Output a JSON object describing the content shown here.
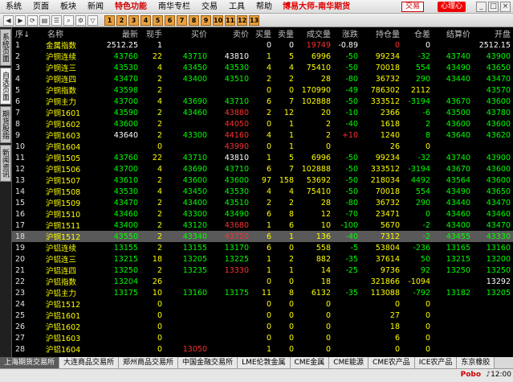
{
  "menu": [
    "系统",
    "页面",
    "板块",
    "新闻",
    "特色功能",
    "南华专栏",
    "交易",
    "工具",
    "帮助"
  ],
  "app_title": "博易大师-南华期货",
  "trade_label": "交易",
  "heart_label": "心理心",
  "window_controls": [
    "_",
    "□",
    "×"
  ],
  "toolbar_icons": [
    "back-icon",
    "forward-icon",
    "refresh-icon",
    "chart-icon",
    "list-icon",
    "search-icon",
    "settings-icon",
    "filter-icon"
  ],
  "toolbar_nums": [
    "1",
    "2",
    "3",
    "4",
    "5",
    "6",
    "7",
    "8",
    "9",
    "10",
    "11",
    "12",
    "13"
  ],
  "side_tabs": [
    "系统页面",
    "自选页面",
    "期货股指",
    "新闻资讯"
  ],
  "headers": [
    "序↓",
    "名称",
    "最新",
    "现手",
    "买价",
    "卖价",
    "买量",
    "卖量",
    "成交量",
    "涨跌",
    "持仓量",
    "仓差",
    "结算价",
    "开盘"
  ],
  "rows": [
    {
      "seq": "1",
      "name": "金属指数",
      "last": "2512.25",
      "vol": "1",
      "bid": "",
      "ask": "",
      "bq": "0",
      "aq": "0",
      "tvol": "19749",
      "chg": "-0.89",
      "oi": "0",
      "oid": "0",
      "settle": "",
      "open": "2512.15",
      "c": [
        "w",
        "w",
        "",
        "",
        "w",
        "w",
        "r",
        "w",
        "r",
        "w",
        "w",
        "w"
      ]
    },
    {
      "seq": "2",
      "name": "沪铜连续",
      "last": "43760",
      "vol": "22",
      "bid": "43710",
      "ask": "43810",
      "bq": "1",
      "aq": "5",
      "tvol": "6996",
      "chg": "-50",
      "oi": "99234",
      "oid": "-32",
      "settle": "43740",
      "open": "43900",
      "c": [
        "g",
        "y",
        "g",
        "w",
        "y",
        "y",
        "y",
        "g",
        "y",
        "g",
        "g",
        "g"
      ]
    },
    {
      "seq": "3",
      "name": "沪铜连三",
      "last": "43530",
      "vol": "4",
      "bid": "43450",
      "ask": "43530",
      "bq": "4",
      "aq": "4",
      "tvol": "75410",
      "chg": "-50",
      "oi": "70018",
      "oid": "554",
      "settle": "43490",
      "open": "43650",
      "c": [
        "g",
        "y",
        "g",
        "g",
        "y",
        "y",
        "y",
        "g",
        "y",
        "g",
        "g",
        "g"
      ]
    },
    {
      "seq": "4",
      "name": "沪铜连四",
      "last": "43470",
      "vol": "2",
      "bid": "43400",
      "ask": "43510",
      "bq": "2",
      "aq": "2",
      "tvol": "28",
      "chg": "-80",
      "oi": "36732",
      "oid": "290",
      "settle": "43440",
      "open": "43470",
      "c": [
        "g",
        "y",
        "g",
        "g",
        "y",
        "y",
        "y",
        "g",
        "y",
        "g",
        "g",
        "g"
      ]
    },
    {
      "seq": "5",
      "name": "沪铜指数",
      "last": "43598",
      "vol": "2",
      "bid": "",
      "ask": "",
      "bq": "0",
      "aq": "0",
      "tvol": "170990",
      "chg": "-49",
      "oi": "786302",
      "oid": "2112",
      "settle": "",
      "open": "43570",
      "c": [
        "g",
        "y",
        "",
        "",
        "y",
        "y",
        "y",
        "g",
        "y",
        "y",
        "",
        "g"
      ]
    },
    {
      "seq": "6",
      "name": "沪铜主力",
      "last": "43700",
      "vol": "4",
      "bid": "43690",
      "ask": "43710",
      "bq": "6",
      "aq": "7",
      "tvol": "102888",
      "chg": "-50",
      "oi": "333512",
      "oid": "-3194",
      "settle": "43670",
      "open": "43600",
      "c": [
        "g",
        "y",
        "g",
        "g",
        "y",
        "y",
        "y",
        "g",
        "y",
        "g",
        "g",
        "g"
      ]
    },
    {
      "seq": "7",
      "name": "沪铜1601",
      "last": "43590",
      "vol": "2",
      "bid": "43460",
      "ask": "43880",
      "bq": "2",
      "aq": "12",
      "tvol": "20",
      "chg": "-10",
      "oi": "2366",
      "oid": "-6",
      "settle": "43500",
      "open": "43780",
      "c": [
        "g",
        "y",
        "g",
        "r",
        "y",
        "y",
        "y",
        "g",
        "y",
        "g",
        "g",
        "g"
      ]
    },
    {
      "seq": "8",
      "name": "沪铜1602",
      "last": "43600",
      "vol": "2",
      "bid": "",
      "ask": "44050",
      "bq": "0",
      "aq": "1",
      "tvol": "2",
      "chg": "-40",
      "oi": "1618",
      "oid": "2",
      "settle": "43600",
      "open": "43600",
      "c": [
        "g",
        "y",
        "",
        "r",
        "y",
        "y",
        "y",
        "g",
        "y",
        "g",
        "g",
        "g"
      ]
    },
    {
      "seq": "9",
      "name": "沪铜1603",
      "last": "43640",
      "vol": "2",
      "bid": "43300",
      "ask": "44160",
      "bq": "4",
      "aq": "1",
      "tvol": "2",
      "chg": "+10",
      "oi": "1240",
      "oid": "8",
      "settle": "43640",
      "open": "43620",
      "c": [
        "w",
        "y",
        "g",
        "r",
        "y",
        "y",
        "y",
        "r",
        "y",
        "g",
        "g",
        "g"
      ]
    },
    {
      "seq": "10",
      "name": "沪铜1604",
      "last": "",
      "vol": "0",
      "bid": "",
      "ask": "43990",
      "bq": "0",
      "aq": "1",
      "tvol": "0",
      "chg": "",
      "oi": "26",
      "oid": "0",
      "settle": "",
      "open": "",
      "c": [
        "",
        "y",
        "",
        "r",
        "y",
        "y",
        "y",
        "",
        "y",
        "y",
        "",
        ""
      ]
    },
    {
      "seq": "11",
      "name": "沪铜1505",
      "last": "43760",
      "vol": "22",
      "bid": "43710",
      "ask": "43810",
      "bq": "1",
      "aq": "5",
      "tvol": "6996",
      "chg": "-50",
      "oi": "99234",
      "oid": "-32",
      "settle": "43740",
      "open": "43900",
      "c": [
        "g",
        "y",
        "g",
        "w",
        "y",
        "y",
        "y",
        "g",
        "y",
        "g",
        "g",
        "g"
      ]
    },
    {
      "seq": "12",
      "name": "沪铜1506",
      "last": "43700",
      "vol": "4",
      "bid": "43690",
      "ask": "43710",
      "bq": "6",
      "aq": "7",
      "tvol": "102888",
      "chg": "-50",
      "oi": "333512",
      "oid": "-3194",
      "settle": "43670",
      "open": "43600",
      "c": [
        "g",
        "y",
        "g",
        "g",
        "y",
        "y",
        "y",
        "g",
        "y",
        "g",
        "g",
        "g"
      ]
    },
    {
      "seq": "13",
      "name": "沪铜1507",
      "last": "43610",
      "vol": "2",
      "bid": "43600",
      "ask": "43600",
      "bq": "97",
      "aq": "158",
      "tvol": "53692",
      "chg": "-50",
      "oi": "218034",
      "oid": "4492",
      "settle": "43564",
      "open": "43600",
      "c": [
        "g",
        "y",
        "g",
        "g",
        "y",
        "y",
        "y",
        "g",
        "y",
        "g",
        "g",
        "g"
      ]
    },
    {
      "seq": "14",
      "name": "沪铜1508",
      "last": "43530",
      "vol": "4",
      "bid": "43450",
      "ask": "43530",
      "bq": "4",
      "aq": "4",
      "tvol": "75410",
      "chg": "-50",
      "oi": "70018",
      "oid": "554",
      "settle": "43490",
      "open": "43650",
      "c": [
        "g",
        "y",
        "g",
        "g",
        "y",
        "y",
        "y",
        "g",
        "y",
        "g",
        "g",
        "g"
      ]
    },
    {
      "seq": "15",
      "name": "沪铜1509",
      "last": "43470",
      "vol": "2",
      "bid": "43400",
      "ask": "43510",
      "bq": "2",
      "aq": "2",
      "tvol": "28",
      "chg": "-80",
      "oi": "36732",
      "oid": "290",
      "settle": "43440",
      "open": "43470",
      "c": [
        "g",
        "y",
        "g",
        "g",
        "y",
        "y",
        "y",
        "g",
        "y",
        "g",
        "g",
        "g"
      ]
    },
    {
      "seq": "16",
      "name": "沪铜1510",
      "last": "43460",
      "vol": "2",
      "bid": "43300",
      "ask": "43490",
      "bq": "6",
      "aq": "8",
      "tvol": "12",
      "chg": "-70",
      "oi": "23471",
      "oid": "0",
      "settle": "43460",
      "open": "43460",
      "c": [
        "g",
        "y",
        "g",
        "g",
        "y",
        "y",
        "y",
        "g",
        "y",
        "g",
        "g",
        "g"
      ]
    },
    {
      "seq": "17",
      "name": "沪铜1511",
      "last": "43400",
      "vol": "2",
      "bid": "43120",
      "ask": "43680",
      "bq": "1",
      "aq": "6",
      "tvol": "10",
      "chg": "-100",
      "oi": "5670",
      "oid": "-2",
      "settle": "43400",
      "open": "43470",
      "c": [
        "g",
        "y",
        "g",
        "r",
        "y",
        "y",
        "y",
        "g",
        "y",
        "g",
        "g",
        "g"
      ]
    },
    {
      "seq": "18",
      "name": "沪铜1512",
      "last": "43550",
      "vol": "2",
      "bid": "43340",
      "ask": "43720",
      "bq": "6",
      "aq": "1",
      "tvol": "136",
      "chg": "-40",
      "oi": "7312",
      "oid": "-2",
      "settle": "43455",
      "open": "43330",
      "c": [
        "g",
        "y",
        "g",
        "r",
        "y",
        "y",
        "y",
        "g",
        "y",
        "g",
        "g",
        "g"
      ],
      "hl": true
    },
    {
      "seq": "19",
      "name": "沪铝连续",
      "last": "13155",
      "vol": "2",
      "bid": "13155",
      "ask": "13170",
      "bq": "6",
      "aq": "0",
      "tvol": "558",
      "chg": "-5",
      "oi": "53804",
      "oid": "-236",
      "settle": "13165",
      "open": "13160",
      "c": [
        "g",
        "y",
        "g",
        "g",
        "y",
        "y",
        "y",
        "g",
        "y",
        "g",
        "g",
        "g"
      ]
    },
    {
      "seq": "20",
      "name": "沪铝连三",
      "last": "13215",
      "vol": "18",
      "bid": "13205",
      "ask": "13225",
      "bq": "1",
      "aq": "2",
      "tvol": "882",
      "chg": "-35",
      "oi": "37614",
      "oid": "50",
      "settle": "13215",
      "open": "13200",
      "c": [
        "g",
        "y",
        "g",
        "g",
        "y",
        "y",
        "y",
        "g",
        "y",
        "g",
        "g",
        "g"
      ]
    },
    {
      "seq": "21",
      "name": "沪铝连四",
      "last": "13250",
      "vol": "2",
      "bid": "13235",
      "ask": "13330",
      "bq": "1",
      "aq": "1",
      "tvol": "14",
      "chg": "-25",
      "oi": "9736",
      "oid": "92",
      "settle": "13250",
      "open": "13250",
      "c": [
        "g",
        "y",
        "g",
        "r",
        "y",
        "y",
        "y",
        "g",
        "y",
        "g",
        "g",
        "g"
      ]
    },
    {
      "seq": "22",
      "name": "沪铝指数",
      "last": "13204",
      "vol": "26",
      "bid": "",
      "ask": "",
      "bq": "0",
      "aq": "0",
      "tvol": "18",
      "chg": "",
      "oi": "321866",
      "oid": "-1094",
      "settle": "",
      "open": "13292",
      "c": [
        "g",
        "y",
        "",
        "",
        "y",
        "y",
        "y",
        "",
        "y",
        "y",
        "",
        "w"
      ]
    },
    {
      "seq": "23",
      "name": "沪铝主力",
      "last": "13175",
      "vol": "10",
      "bid": "13160",
      "ask": "13175",
      "bq": "11",
      "aq": "8",
      "tvol": "6132",
      "chg": "-35",
      "oi": "113088",
      "oid": "-792",
      "settle": "13182",
      "open": "13205",
      "c": [
        "g",
        "y",
        "g",
        "g",
        "y",
        "y",
        "y",
        "g",
        "y",
        "g",
        "g",
        "g"
      ]
    },
    {
      "seq": "24",
      "name": "沪铝1512",
      "last": "",
      "vol": "0",
      "bid": "",
      "ask": "",
      "bq": "0",
      "aq": "0",
      "tvol": "0",
      "chg": "",
      "oi": "0",
      "oid": "0",
      "settle": "",
      "open": "",
      "c": [
        "",
        "y",
        "",
        "",
        "y",
        "y",
        "y",
        "",
        "y",
        "y",
        "",
        ""
      ]
    },
    {
      "seq": "25",
      "name": "沪铝1601",
      "last": "",
      "vol": "0",
      "bid": "",
      "ask": "",
      "bq": "0",
      "aq": "0",
      "tvol": "0",
      "chg": "",
      "oi": "27",
      "oid": "0",
      "settle": "",
      "open": "",
      "c": [
        "",
        "y",
        "",
        "",
        "y",
        "y",
        "y",
        "",
        "y",
        "y",
        "",
        ""
      ]
    },
    {
      "seq": "26",
      "name": "沪铝1602",
      "last": "",
      "vol": "0",
      "bid": "",
      "ask": "",
      "bq": "0",
      "aq": "0",
      "tvol": "0",
      "chg": "",
      "oi": "18",
      "oid": "0",
      "settle": "",
      "open": "",
      "c": [
        "",
        "y",
        "",
        "",
        "y",
        "y",
        "y",
        "",
        "y",
        "y",
        "",
        ""
      ]
    },
    {
      "seq": "27",
      "name": "沪铝1603",
      "last": "",
      "vol": "0",
      "bid": "",
      "ask": "",
      "bq": "0",
      "aq": "0",
      "tvol": "0",
      "chg": "",
      "oi": "6",
      "oid": "0",
      "settle": "",
      "open": "",
      "c": [
        "",
        "y",
        "",
        "",
        "y",
        "y",
        "y",
        "",
        "y",
        "y",
        "",
        ""
      ]
    },
    {
      "seq": "28",
      "name": "沪铝1604",
      "last": "",
      "vol": "0",
      "bid": "13050",
      "ask": "",
      "bq": "1",
      "aq": "0",
      "tvol": "0",
      "chg": "",
      "oi": "0",
      "oid": "0",
      "settle": "",
      "open": "",
      "c": [
        "",
        "y",
        "r",
        "",
        "y",
        "y",
        "y",
        "",
        "y",
        "y",
        "",
        ""
      ]
    },
    {
      "seq": "29",
      "name": "沪铝1505",
      "last": "13155",
      "vol": "2",
      "bid": "13155",
      "ask": "13170",
      "bq": "6",
      "aq": "0",
      "tvol": "558",
      "chg": "-5",
      "oi": "53804",
      "oid": "-236",
      "settle": "13165",
      "open": "13160",
      "c": [
        "g",
        "y",
        "g",
        "g",
        "y",
        "y",
        "y",
        "g",
        "y",
        "g",
        "g",
        "g"
      ]
    }
  ],
  "bottom_tabs": [
    "上海期货交易所",
    "大连商品交易所",
    "郑州商品交易所",
    "中国金融交易所",
    "LME伦敦金属",
    "CME金属",
    "CME能源",
    "CME农产品",
    "ICE农产品",
    "东京橡胶"
  ],
  "status": {
    "brand": "Pobo",
    "clock": "12:00"
  }
}
